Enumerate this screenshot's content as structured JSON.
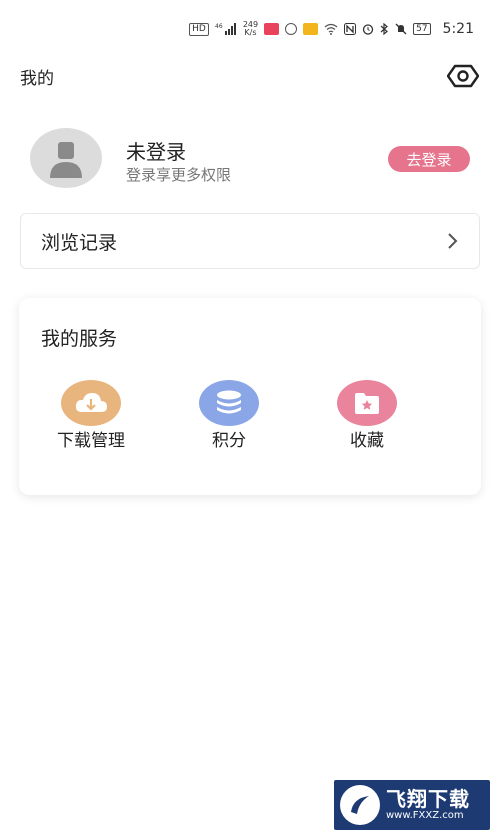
{
  "status_bar": {
    "hd": "HD",
    "signal": "46",
    "net_speed_value": "249",
    "net_speed_unit": "K/s",
    "battery": "57",
    "time": "5:21"
  },
  "header": {
    "title": "我的",
    "eye_icon": "eye-icon"
  },
  "profile": {
    "name": "未登录",
    "subtitle": "登录享更多权限",
    "login_button": "去登录",
    "login_color": "#e5748c"
  },
  "history": {
    "label": "浏览记录"
  },
  "services": {
    "title": "我的服务",
    "items": [
      {
        "label": "下载管理",
        "icon": "cloud-download-icon",
        "color": "#e9b57e"
      },
      {
        "label": "积分",
        "icon": "coins-icon",
        "color": "#8aa6e6"
      },
      {
        "label": "收藏",
        "icon": "star-folder-icon",
        "color": "#e9849c"
      }
    ]
  },
  "watermark": {
    "title": "飞翔下载",
    "url": "www.FXXZ.com"
  }
}
